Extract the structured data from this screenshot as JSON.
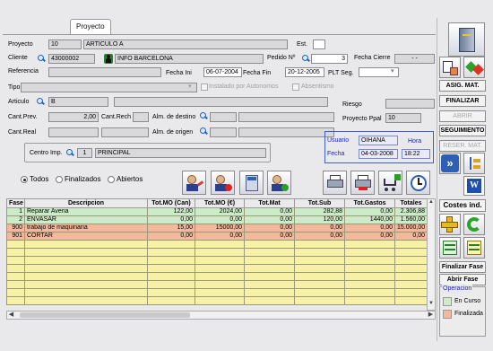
{
  "tab": {
    "label": "Proyecto"
  },
  "header": {
    "proyecto": {
      "label": "Proyecto",
      "code": "10",
      "name": "ARTICULO A"
    },
    "est": {
      "label": "Est.",
      "value": ""
    },
    "cliente": {
      "label": "Cliente",
      "code": "43000002",
      "name": "INFO BARCELONA"
    },
    "pedido": {
      "label": "Pedido Nº",
      "value": "3"
    },
    "fecha_cierre": {
      "label": "Fecha Cierre",
      "value": "- -"
    },
    "referencia": {
      "label": "Referencia",
      "value": ""
    },
    "fecha_ini": {
      "label": "Fecha Ini",
      "value": "06-07-2004"
    },
    "fecha_fin": {
      "label": "Fecha Fin",
      "value": "20-12-2005"
    },
    "plt_seg": {
      "label": "PLT Seg.",
      "value": ""
    },
    "tipo": {
      "label": "Tipo",
      "value": ""
    },
    "instalado": {
      "label": "Instalado por Autonomos"
    },
    "absentismo": {
      "label": "Absentismo"
    },
    "articulo": {
      "label": "Articulo",
      "value": "B"
    },
    "riesgo": {
      "label": "Riesgo",
      "value": ""
    },
    "cant_prev": {
      "label": "Cant.Prev.",
      "value": "2,00"
    },
    "cant_rech": {
      "label": "Cant.Rech",
      "value": ""
    },
    "alm_destino": {
      "label": "Alm. de destino",
      "value": ""
    },
    "proyecto_ppal": {
      "label": "Proyecto Ppal",
      "value": "10"
    },
    "cant_real": {
      "label": "Cant.Real",
      "value": ""
    },
    "alm_origen": {
      "label": "Alm. de origen",
      "value": ""
    },
    "centro_imp": {
      "label": "Centro Imp.",
      "code": "1",
      "name": "PRINCIPAL"
    },
    "usuario": {
      "label": "Usuario",
      "value": "OIHANA"
    },
    "hora": {
      "label": "Hora",
      "value": "18:22"
    },
    "fecha": {
      "label": "Fecha",
      "value": "04-03-2008"
    }
  },
  "filter": {
    "options": [
      "Todos",
      "Finalizados",
      "Abiertos"
    ],
    "selected": "Todos"
  },
  "table": {
    "columns": [
      "Fase",
      "Descripcion",
      "Tot.MO (Can)",
      "Tot.MO (€)",
      "Tot.Mat",
      "Tot.Sub",
      "Tot.Gastos",
      "Totales"
    ],
    "rows": [
      {
        "fase": "1",
        "descripcion": "Reparar Averia",
        "mo_can": "122,00",
        "mo_eur": "2024,00",
        "mat": "0,00",
        "sub": "282,88",
        "gastos": "0,00",
        "totales": "2.306,88",
        "status": "green"
      },
      {
        "fase": "2",
        "descripcion": "ENVASAR",
        "mo_can": "0,00",
        "mo_eur": "0,00",
        "mat": "0,00",
        "sub": "120,00",
        "gastos": "1440,00",
        "totales": "1.560,00",
        "status": "green"
      },
      {
        "fase": "900",
        "descripcion": "trabajo de maquinaria",
        "mo_can": "15,00",
        "mo_eur": "15000,00",
        "mat": "0,00",
        "sub": "0,00",
        "gastos": "0,00",
        "totales": "15.000,00",
        "status": "orange"
      },
      {
        "fase": "901",
        "descripcion": "CORTAR",
        "mo_can": "0,00",
        "mo_eur": "0,00",
        "mat": "0,00",
        "sub": "0,00",
        "gastos": "0,00",
        "totales": "0,00",
        "status": "orange"
      }
    ]
  },
  "sidebar": {
    "asig_mat": "ASIG. MAT.",
    "finalizar": "FINALIZAR",
    "abrir": "ABRIR",
    "seguimiento": "SEGUIMIENTO",
    "reser_mat": "RESER. MAT.",
    "costes_ind": "Costes ind.",
    "finalizar_fase": "Finalizar Fase",
    "abrir_fase": "Abrir Fase",
    "operacion": "Operacion",
    "en_curso": "En Curso",
    "finalizada": "Finalizada"
  },
  "colors": {
    "green_row": "#cdebc9",
    "orange_row": "#f4b99d",
    "empty_row": "#f7f1a6",
    "info_box_border": "#3d5cd6",
    "info_label": "#1b1bc8"
  }
}
